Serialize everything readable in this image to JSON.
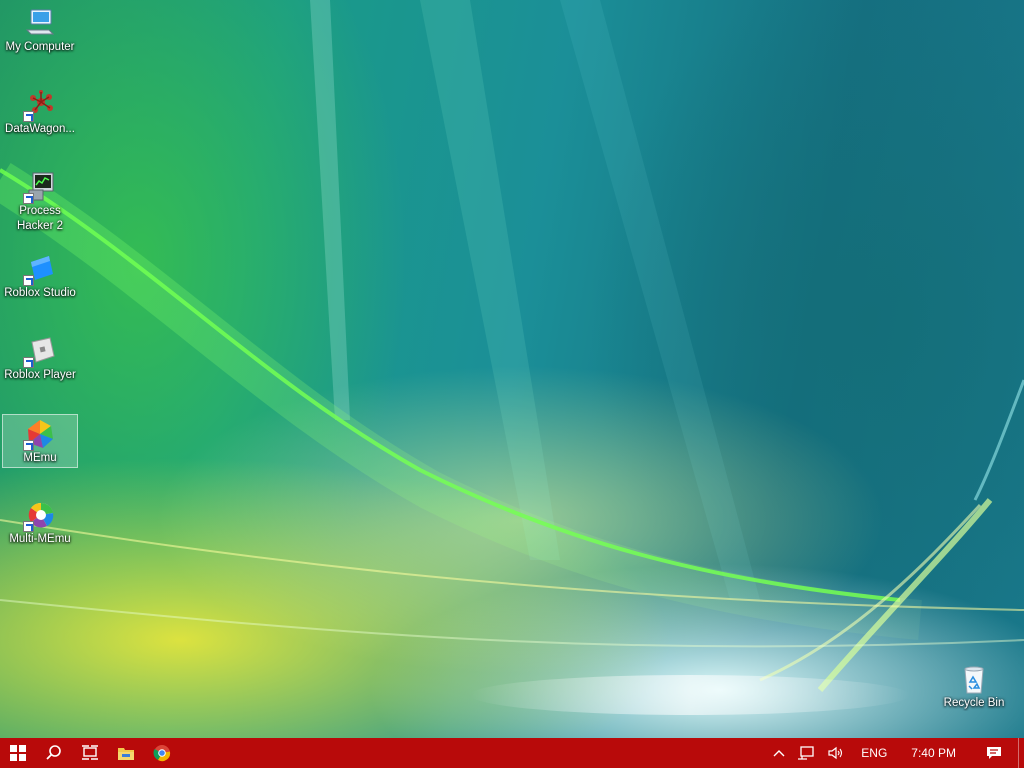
{
  "desktop": {
    "icons": [
      {
        "label": "My Computer",
        "icon": "computer-icon"
      },
      {
        "label": "DataWagon...",
        "icon": "datawagon-icon"
      },
      {
        "label": "Process Hacker 2",
        "icon": "process-hacker-icon"
      },
      {
        "label": "Roblox Studio",
        "icon": "roblox-studio-icon"
      },
      {
        "label": "Roblox Player",
        "icon": "roblox-player-icon"
      },
      {
        "label": "MEmu",
        "icon": "memu-icon",
        "selected": true
      },
      {
        "label": "Multi-MEmu",
        "icon": "multi-memu-icon"
      },
      {
        "label": "Recycle Bin",
        "icon": "recycle-bin-icon"
      }
    ]
  },
  "taskbar": {
    "color": "#b80a0a",
    "pinned": [
      "start-icon",
      "search-icon",
      "task-view-icon",
      "file-explorer-icon",
      "chrome-icon"
    ],
    "tray": {
      "language": "ENG",
      "time": "7:40 PM"
    }
  }
}
